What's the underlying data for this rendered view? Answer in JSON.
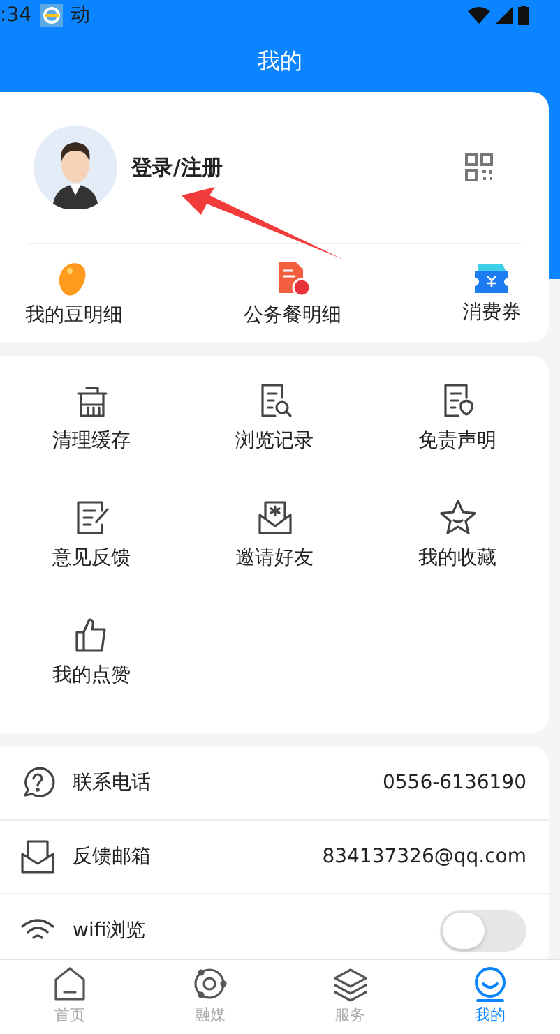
{
  "status_bar": {
    "time": ":34",
    "notification": "动"
  },
  "header": {
    "title": "我的"
  },
  "profile": {
    "login_label": "登录/注册"
  },
  "shortcuts": [
    {
      "label": "我的豆明细",
      "kind": "bean"
    },
    {
      "label": "公务餐明细",
      "kind": "meal"
    },
    {
      "label": "消费券",
      "kind": "coupon"
    }
  ],
  "tools": [
    {
      "label": "清理缓存",
      "kind": "trash"
    },
    {
      "label": "浏览记录",
      "kind": "history"
    },
    {
      "label": "免责声明",
      "kind": "shield-doc"
    },
    {
      "label": "意见反馈",
      "kind": "edit-doc"
    },
    {
      "label": "邀请好友",
      "kind": "invite"
    },
    {
      "label": "我的收藏",
      "kind": "star"
    },
    {
      "label": "我的点赞",
      "kind": "like"
    }
  ],
  "contacts": [
    {
      "kind": "phone",
      "label": "联系电话",
      "value": "0556-6136190"
    },
    {
      "kind": "mail",
      "label": "反馈邮箱",
      "value": "834137326@qq.com"
    },
    {
      "kind": "toggle",
      "label": "wifi浏览",
      "on": false
    }
  ],
  "tabs": [
    {
      "label": "首页",
      "kind": "home",
      "selected": false
    },
    {
      "label": "融媒",
      "kind": "orbit",
      "selected": false
    },
    {
      "label": "服务",
      "kind": "layers",
      "selected": false
    },
    {
      "label": "我的",
      "kind": "smile",
      "selected": true
    }
  ]
}
